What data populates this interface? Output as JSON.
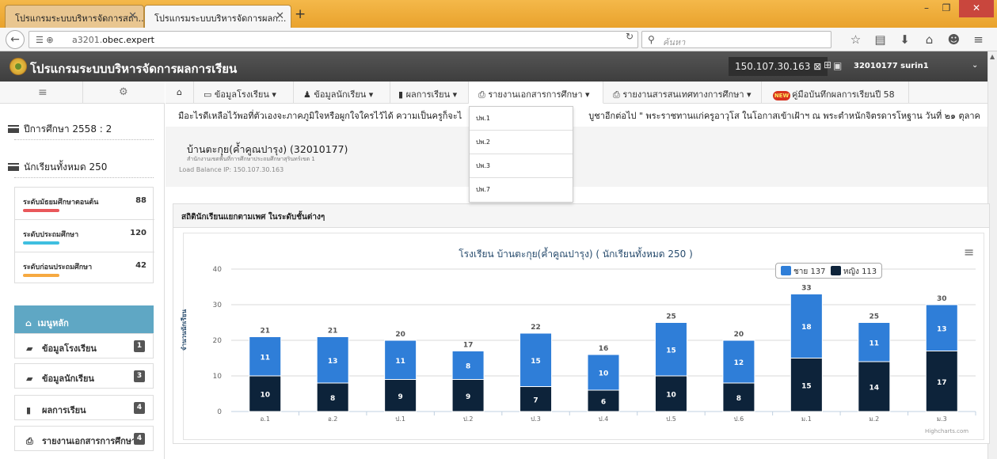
{
  "browser": {
    "tabs": [
      {
        "label": "โปรแกรมระบบบริหารจัดการสถา...",
        "active": false
      },
      {
        "label": "โปรแกรมระบบบริหารจัดการผลก...",
        "active": true
      }
    ],
    "new_tab": "+",
    "url_prefix": "a3201.",
    "url_domain": "obec.expert",
    "search_placeholder": "ค้นหา"
  },
  "app": {
    "title": "โปรแกรมระบบบริหารจัดการผลการเรียน",
    "server_ip": "150.107.30.163",
    "user": "32010177 surin1"
  },
  "sidebar": {
    "year": "ปีการศึกษา 2558 : 2",
    "total_students": "นักเรียนทั้งหมด 250",
    "levels": [
      {
        "name": "ระดับมัธยมศึกษาตอนต้น",
        "value": "88",
        "color": "#e9585b"
      },
      {
        "name": "ระดับประถมศึกษา",
        "value": "120",
        "color": "#3fbfe0"
      },
      {
        "name": "ระดับก่อนประถมศึกษา",
        "value": "42",
        "color": "#f6a941"
      }
    ],
    "menu_title": "เมนูหลัก",
    "menu_items": [
      {
        "label": "ข้อมูลโรงเรียน",
        "badge": "1",
        "icon": "folder-icon"
      },
      {
        "label": "ข้อมูลนักเรียน",
        "badge": "3",
        "icon": "folder-icon"
      },
      {
        "label": "ผลการเรียน",
        "badge": "4",
        "icon": "book-icon"
      },
      {
        "label": "รายงานเอกสารการศึกษา",
        "badge": "4",
        "icon": "print-icon"
      }
    ]
  },
  "topmenu": {
    "items": [
      {
        "label": "ข้อมูลโรงเรียน ▾"
      },
      {
        "label": "ข้อมูลนักเรียน ▾"
      },
      {
        "label": "ผลการเรียน ▾"
      },
      {
        "label": "รายงานเอกสารการศึกษา ▾"
      },
      {
        "label": "รายงานสารสนเทศทางการศึกษา ▾"
      },
      {
        "label": "คู่มือบันทึกผลการเรียนปี 58",
        "new": "NEW"
      }
    ]
  },
  "dropdown": [
    "ปพ.1",
    "ปพ.2",
    "ปพ.3",
    "ปพ.7"
  ],
  "marquee": "มือะไรดีเหลือไว้พอที่ตัวเองจะภาคภูมิใจหรือผูกใจใครไว้ได้ ความเป็นครูก็จะไ",
  "marquee_tail": "บูชาอีกต่อไป \" พระราชทานแก่ครูอาวุโส ในโอกาสเข้าเฝ้าฯ ณ พระตำหนักจิตรดารโหฐาน วันที่ ๒๑ ตุลาค",
  "school": {
    "name": "บ้านตะกุย(ค้ำคูณปารุง) (32010177)",
    "area": "สำนักงานเขตพื้นที่การศึกษาประถมศึกษาสุรินทร์เขต 1",
    "load_balance": "Load Balance IP: 150.107.30.163"
  },
  "stats_title": "สถิตินักเรียนแยกตามเพศ ในระดับชั้นต่างๆ",
  "chart_data": {
    "type": "bar",
    "stacked": true,
    "title": "โรงเรียน บ้านตะกุย(ค้ำคูณปารุง) ( นักเรียนทั้งหมด 250 )",
    "ylabel": "จำนวนนักเรียน",
    "ylim": [
      0,
      40
    ],
    "yticks": [
      0,
      10,
      20,
      30,
      40
    ],
    "categories": [
      "อ.1",
      "อ.2",
      "ป.1",
      "ป.2",
      "ป.3",
      "ป.4",
      "ป.5",
      "ป.6",
      "ม.1",
      "ม.2",
      "ม.3"
    ],
    "totals": [
      21,
      21,
      20,
      17,
      22,
      16,
      25,
      20,
      33,
      25,
      30
    ],
    "series": [
      {
        "name": "ชาย 137",
        "color": "#2f7ed8",
        "values": [
          11,
          13,
          11,
          8,
          15,
          10,
          15,
          12,
          18,
          11,
          13
        ]
      },
      {
        "name": "หญิง 113",
        "color": "#0d233a",
        "values": [
          10,
          8,
          9,
          9,
          7,
          6,
          10,
          8,
          15,
          14,
          17
        ]
      }
    ],
    "legend": "top-right",
    "credits": "Highcharts.com"
  }
}
